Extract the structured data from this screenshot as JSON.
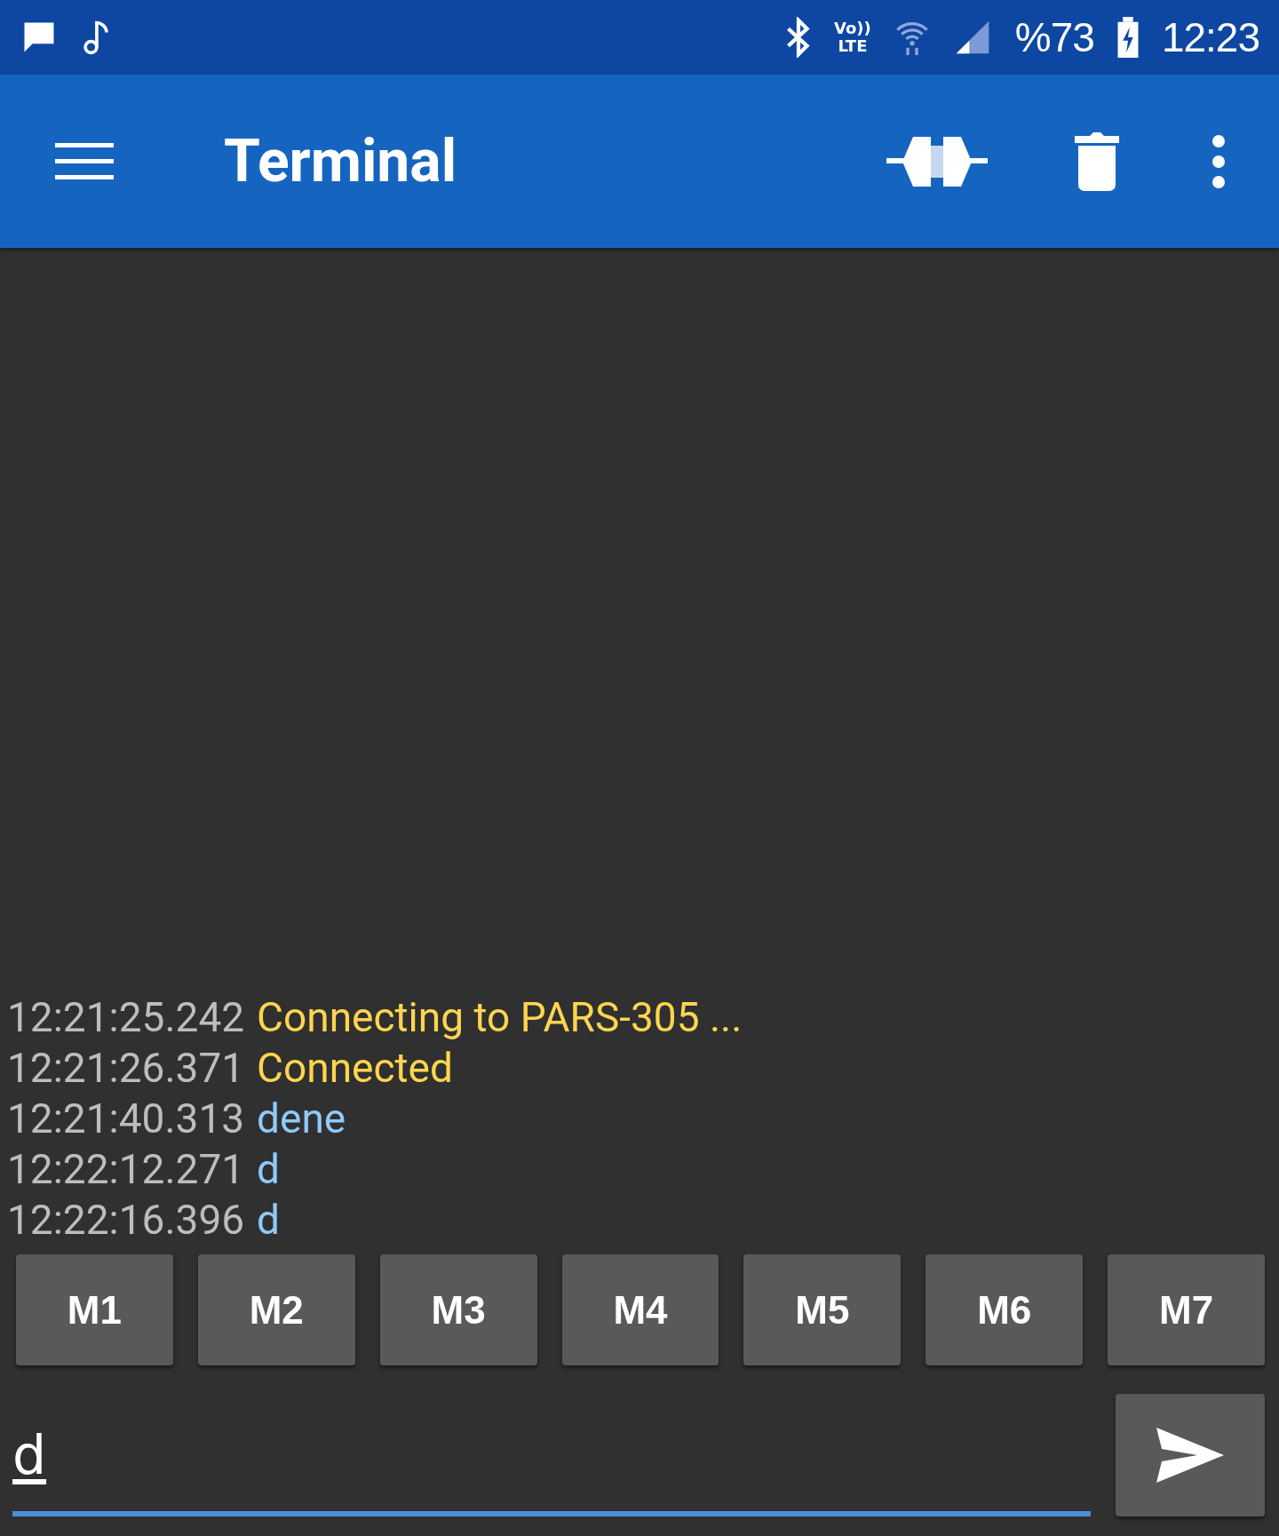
{
  "status_bar": {
    "volte_top": "Vo))",
    "volte_bottom": "LTE",
    "battery": "%73",
    "time": "12:23"
  },
  "toolbar": {
    "title": "Terminal"
  },
  "log": [
    {
      "time": "12:21:25.242",
      "text": "Connecting to PARS-305 ...",
      "kind": "status"
    },
    {
      "time": "12:21:26.371",
      "text": "Connected",
      "kind": "status"
    },
    {
      "time": "12:21:40.313",
      "text": "dene",
      "kind": "received"
    },
    {
      "time": "12:22:12.271",
      "text": "d",
      "kind": "received"
    },
    {
      "time": "12:22:16.396",
      "text": "d",
      "kind": "received"
    }
  ],
  "macros": [
    "M1",
    "M2",
    "M3",
    "M4",
    "M5",
    "M6",
    "M7"
  ],
  "input": {
    "value": "d"
  }
}
